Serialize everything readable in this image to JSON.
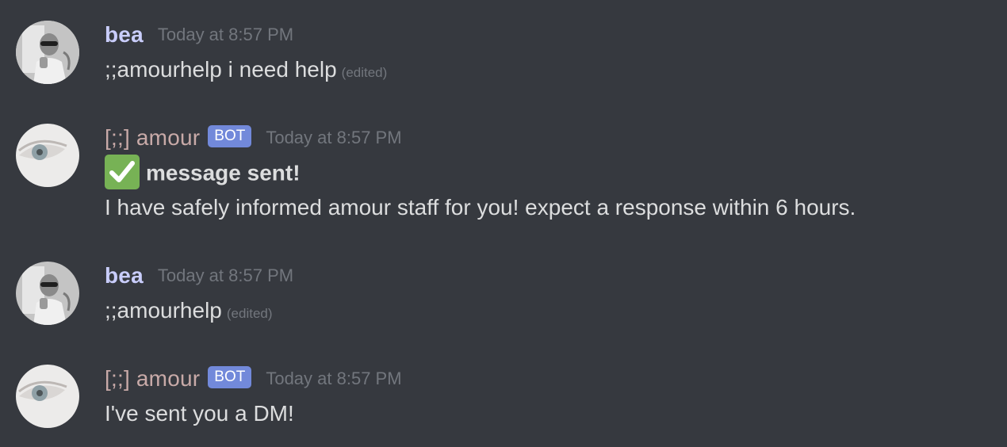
{
  "messages": [
    {
      "author": "bea",
      "timestamp": "Today at 8:57 PM",
      "text": ";;amourhelp i need help",
      "edited": "(edited)"
    },
    {
      "author": "[;;] amour",
      "bot_tag": "BOT",
      "timestamp": "Today at 8:57 PM",
      "title": "message sent!",
      "text": "I have safely informed amour staff for you! expect a response within 6 hours.",
      "emoji": "check-mark-button-icon"
    },
    {
      "author": "bea",
      "timestamp": "Today at 8:57 PM",
      "text": ";;amourhelp",
      "edited": "(edited)"
    },
    {
      "author": "[;;] amour",
      "bot_tag": "BOT",
      "timestamp": "Today at 8:57 PM",
      "text": "I've sent you a DM!"
    }
  ],
  "colors": {
    "background": "#36393f",
    "bea_name": "#c9cdfb",
    "amour_name": "#c8aaa8",
    "bot_tag": "#7289da",
    "timestamp": "#72767d",
    "message_text": "#dcddde",
    "check_emoji": "#77b255"
  }
}
